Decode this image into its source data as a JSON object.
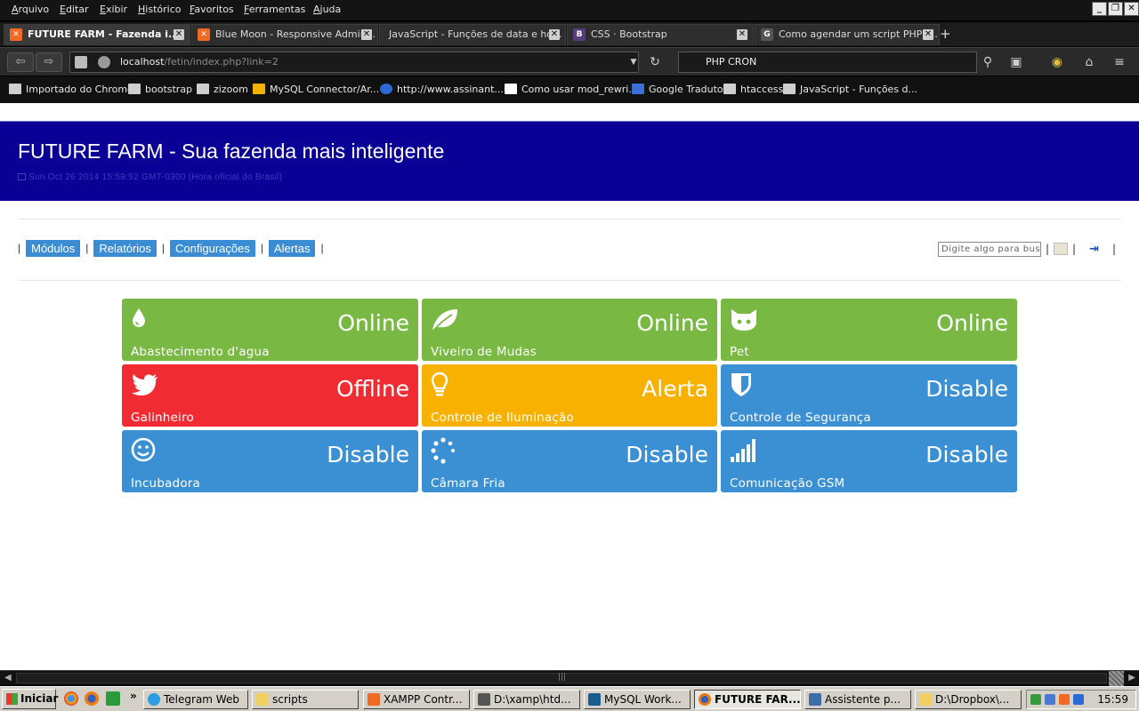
{
  "menu": [
    "Arquivo",
    "Editar",
    "Exibir",
    "Histórico",
    "Favoritos",
    "Ferramentas",
    "Ajuda"
  ],
  "tabs": [
    {
      "label": "FUTURE FARM - Fazenda i...",
      "icon": "xampp-icon",
      "active": true
    },
    {
      "label": "Blue Moon - Responsive Admin...",
      "icon": "xampp-icon"
    },
    {
      "label": "JavaScript - Funções de data e ho...",
      "icon": ""
    },
    {
      "label": "CSS · Bootstrap",
      "icon": "bootstrap-icon"
    },
    {
      "label": "Como agendar um script PHP u...",
      "icon": "google-icon"
    }
  ],
  "nav": {
    "url_host": "localhost",
    "url_path": "/fetin/index.php?link=2",
    "search_value": "PHP CRON"
  },
  "bookmarks": [
    {
      "label": "Importado do Chrome",
      "icon": "folder-icon"
    },
    {
      "label": "bootstrap",
      "icon": "folder-icon"
    },
    {
      "label": "zizoom",
      "icon": "folder-icon"
    },
    {
      "label": "MySQL Connector/Ar...",
      "icon": "lp-icon"
    },
    {
      "label": "http://www.assinant...",
      "icon": "globe-icon"
    },
    {
      "label": "Como usar mod_rewri...",
      "icon": "gd-icon"
    },
    {
      "label": "Google Tradutor",
      "icon": "translate-icon"
    },
    {
      "label": "htaccess",
      "icon": "page-icon"
    },
    {
      "label": "JavaScript - Funções d...",
      "icon": "page-icon"
    }
  ],
  "page": {
    "title": "FUTURE FARM - Sua fazenda mais inteligente",
    "clock": "Sun Oct 26 2014 15:59:52 GMT-0300 (Hora oficial do Brasil)",
    "nav_links": [
      "Módulos",
      "Relatórios",
      "Configurações",
      "Alertas"
    ],
    "search_placeholder": "Digite algo para buscar",
    "tiles": [
      {
        "label": "Abastecimento d'agua",
        "status": "Online",
        "color": "#78b843",
        "icon": "water-drop-icon"
      },
      {
        "label": "Viveiro de Mudas",
        "status": "Online",
        "color": "#78b843",
        "icon": "leaf-icon"
      },
      {
        "label": "Pet",
        "status": "Online",
        "color": "#78b843",
        "icon": "cat-icon"
      },
      {
        "label": "Galinheiro",
        "status": "Offline",
        "color": "#f02c32",
        "icon": "bird-icon"
      },
      {
        "label": "Controle de Iluminação",
        "status": "Alerta",
        "color": "#f9b100",
        "icon": "lightbulb-icon"
      },
      {
        "label": "Controle de Segurança",
        "status": "Disable",
        "color": "#3a90d2",
        "icon": "shield-icon"
      },
      {
        "label": "Incubadora",
        "status": "Disable",
        "color": "#3a90d2",
        "icon": "smiley-icon"
      },
      {
        "label": "Câmara Fria",
        "status": "Disable",
        "color": "#3a90d2",
        "icon": "spinner-icon"
      },
      {
        "label": "Comunicação GSM",
        "status": "Disable",
        "color": "#3a90d2",
        "icon": "signal-icon"
      }
    ]
  },
  "taskbar": {
    "start_label": "Iniciar",
    "tasks": [
      {
        "label": "Telegram Web"
      },
      {
        "label": "scripts"
      },
      {
        "label": "XAMPP Contr..."
      },
      {
        "label": "D:\\xamp\\htd..."
      },
      {
        "label": "MySQL Work..."
      },
      {
        "label": "FUTURE FAR...",
        "active": true
      },
      {
        "label": "Assistente p..."
      },
      {
        "label": "D:\\Dropbox\\..."
      }
    ],
    "time": "15:59"
  }
}
